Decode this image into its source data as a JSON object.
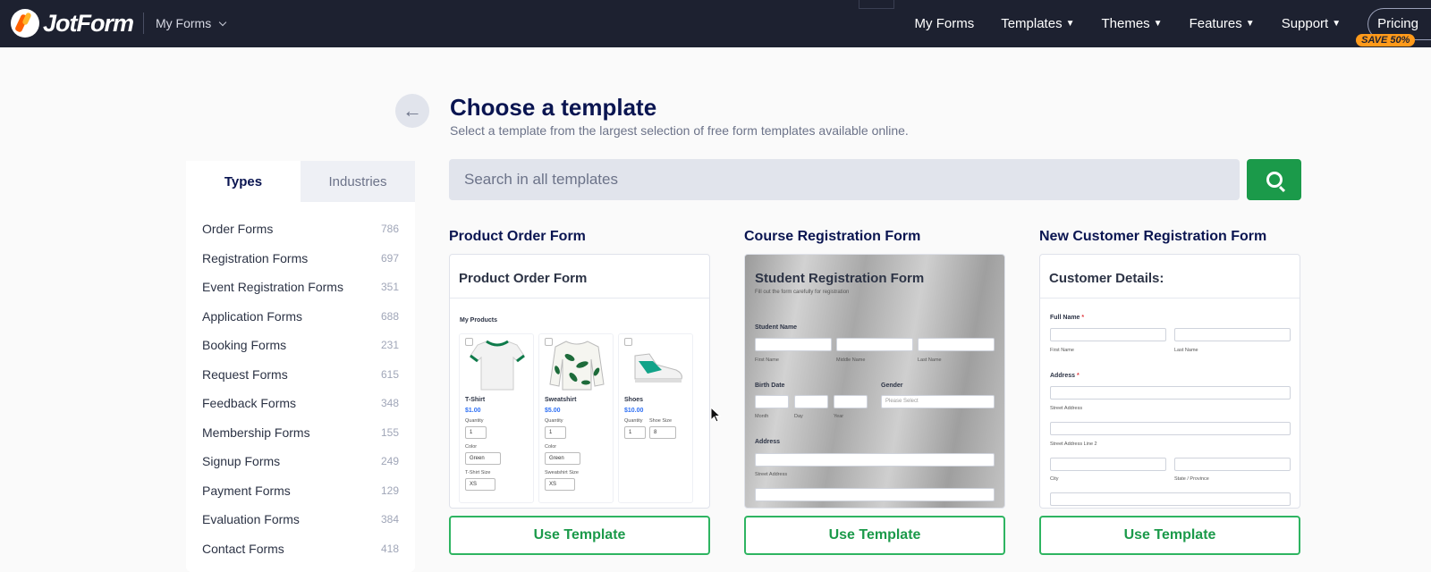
{
  "topbar": {
    "logo_text": "JotForm",
    "myforms_dropdown": "My Forms",
    "nav": [
      "My Forms",
      "Templates",
      "Themes",
      "Features",
      "Support"
    ],
    "pricing": "Pricing",
    "save_badge": "SAVE 50%"
  },
  "header": {
    "title": "Choose a template",
    "subtitle": "Select a template from the largest selection of free form templates available online."
  },
  "sidebar": {
    "tabs": [
      "Types",
      "Industries"
    ],
    "categories": [
      {
        "label": "Order Forms",
        "count": "786"
      },
      {
        "label": "Registration Forms",
        "count": "697"
      },
      {
        "label": "Event Registration Forms",
        "count": "351"
      },
      {
        "label": "Application Forms",
        "count": "688"
      },
      {
        "label": "Booking Forms",
        "count": "231"
      },
      {
        "label": "Request Forms",
        "count": "615"
      },
      {
        "label": "Feedback Forms",
        "count": "348"
      },
      {
        "label": "Membership Forms",
        "count": "155"
      },
      {
        "label": "Signup Forms",
        "count": "249"
      },
      {
        "label": "Payment Forms",
        "count": "129"
      },
      {
        "label": "Evaluation Forms",
        "count": "384"
      },
      {
        "label": "Contact Forms",
        "count": "418"
      }
    ]
  },
  "search": {
    "placeholder": "Search in all templates"
  },
  "templates": [
    {
      "title": "Product Order Form",
      "preview_title": "Product Order Form",
      "section": "My Products",
      "products": [
        {
          "name": "T-Shirt",
          "price": "$1.00",
          "qty_label": "Quantity",
          "qty": "1",
          "color_label": "Color",
          "color": "Green",
          "size_label": "T-Shirt Size",
          "size": "XS"
        },
        {
          "name": "Sweatshirt",
          "price": "$5.00",
          "qty_label": "Quantity",
          "qty": "1",
          "color_label": "Color",
          "color": "Green",
          "size_label": "Sweatshirt Size",
          "size": "XS"
        },
        {
          "name": "Shoes",
          "price": "$10.00",
          "qty_label": "Quantity",
          "qty": "1",
          "size_label": "Shoe Size",
          "size": "8"
        }
      ],
      "button": "Use Template"
    },
    {
      "title": "Course Registration Form",
      "preview_title": "Student Registration Form",
      "preview_sub": "Fill out the form carefully for registration",
      "student_name": "Student Name",
      "first": "First Name",
      "middle": "Middle Name",
      "last": "Last Name",
      "birth_date": "Birth Date",
      "gender": "Gender",
      "please_select": "Please Select",
      "month": "Month",
      "day": "Day",
      "year": "Year",
      "address": "Address",
      "street": "Street Address",
      "button": "Use Template"
    },
    {
      "title": "New Customer Registration Form",
      "preview_title": "Customer Details:",
      "full_name": "Full Name",
      "first": "First Name",
      "last": "Last Name",
      "address": "Address",
      "street": "Street Address",
      "street2": "Street Address Line 2",
      "city": "City",
      "state": "State / Province",
      "button": "Use Template"
    }
  ],
  "colors": {
    "topbar": "#1d2130",
    "accent_green": "#1b9a4a",
    "save_badge": "#ff9a1a",
    "text_dark": "#0a1551"
  }
}
